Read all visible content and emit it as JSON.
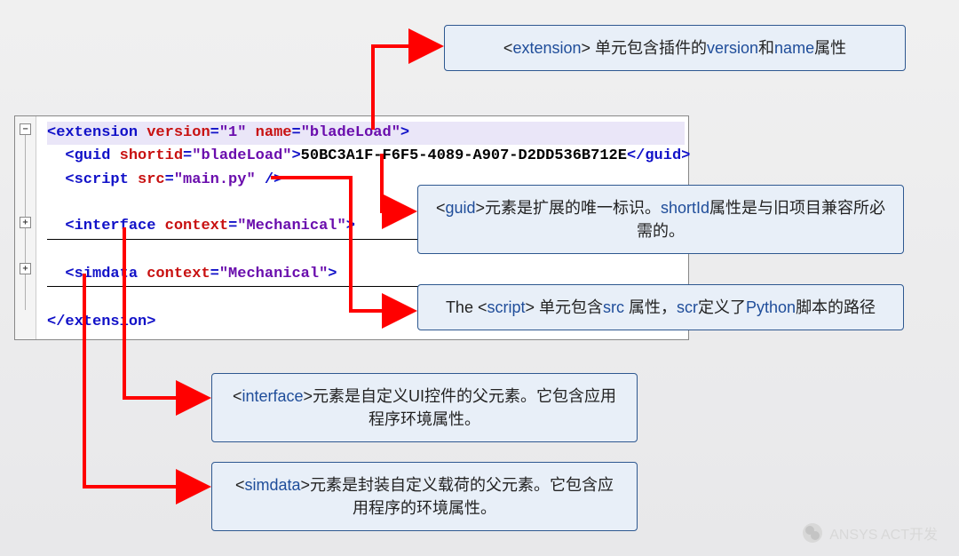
{
  "code": {
    "l1": {
      "tag_open": "<extension",
      "attr1": " version",
      "eq1": "=",
      "val1": "\"1\"",
      "attr2": " name",
      "eq2": "=",
      "val2": "\"bladeLoad\"",
      "close": ">"
    },
    "l2": {
      "indent": "  ",
      "tag_open": "<guid",
      "attr1": " shortid",
      "eq1": "=",
      "val1": "\"bladeLoad\"",
      "close": ">",
      "text": "50BC3A1F-F6F5-4089-A907-D2DD536B712E",
      "tag_close": "</guid>"
    },
    "l3": {
      "indent": "  ",
      "tag_open": "<script",
      "attr1": " src",
      "eq1": "=",
      "val1": "\"main.py\"",
      "close": " />"
    },
    "l4": {
      "indent": "  ",
      "tag_open": "<interface",
      "attr1": " context",
      "eq1": "=",
      "val1": "\"Mechanical\"",
      "close": ">"
    },
    "l5": {
      "indent": "  ",
      "tag_open": "<simdata",
      "attr1": " context",
      "eq1": "=",
      "val1": "\"Mechanical\"",
      "close": ">"
    },
    "l6": {
      "tag_close": "</extension>"
    }
  },
  "callouts": {
    "c1": {
      "kw1": "extension",
      "t1": "<",
      "t2": "> 单元包含插件的",
      "kw2": "version",
      "t3": "和",
      "kw3": "name",
      "t4": "属性"
    },
    "c2": {
      "t1": "<",
      "kw1": "guid",
      "t2": ">元素是扩展的唯一标识。",
      "kw2": "shortId",
      "t3": "属性是与旧项目兼容所必需的。"
    },
    "c3": {
      "t1": "The <",
      "kw1": "script",
      "t2": "> 单元包含",
      "kw2": "src",
      "t3": " 属性，",
      "kw3": "scr",
      "t4": "定义了",
      "kw4": "Python",
      "t5": "脚本的路径"
    },
    "c4": {
      "t1": "<",
      "kw1": "interface",
      "t2": ">元素是自定义UI控件的父元素。它包含应用程序环境属性。"
    },
    "c5": {
      "t1": "<",
      "kw1": "simdata",
      "t2": ">元素是封装自定义载荷的父元素。它包含应用程序的环境属性。"
    }
  },
  "gutter": {
    "minus": "−",
    "plus": "+"
  },
  "watermark": "ANSYS ACT开发"
}
